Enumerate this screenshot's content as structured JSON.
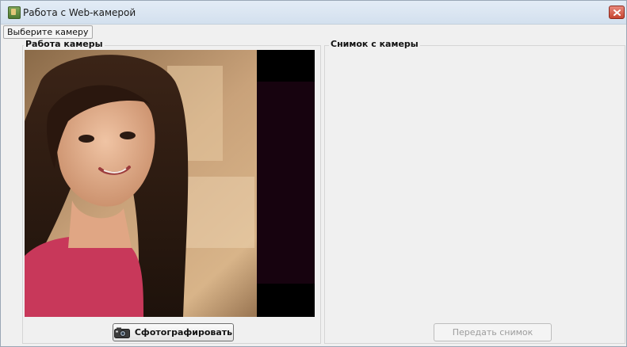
{
  "window": {
    "title": "Работа с Web-камерой"
  },
  "menu": {
    "select_camera_label": "Выберите камеру"
  },
  "left_panel": {
    "label": "Работа камеры",
    "take_photo_label": "Сфотографировать"
  },
  "right_panel": {
    "label": "Снимок с камеры",
    "send_photo_label": "Передать снимок",
    "send_photo_enabled": false
  },
  "icons": {
    "app": "webcam-app-icon",
    "close": "close-icon",
    "camera": "camera-icon"
  },
  "colors": {
    "close_button": "#c64530",
    "window_background": "#f0f0f0",
    "disabled_text": "#9c9c9c"
  }
}
